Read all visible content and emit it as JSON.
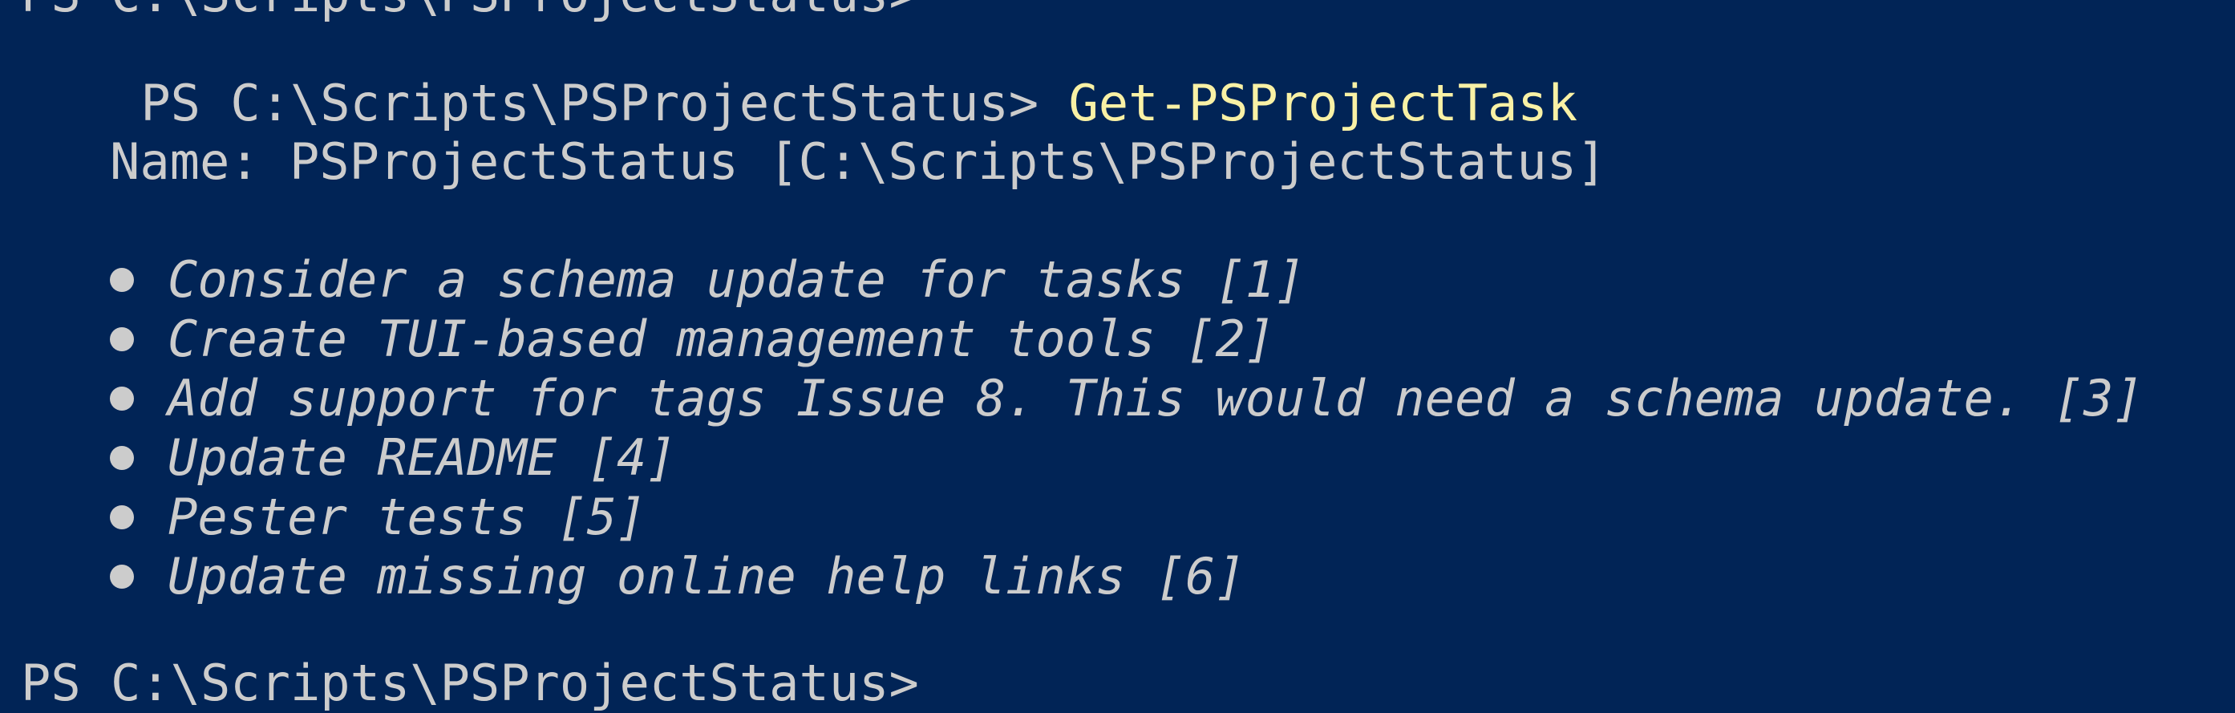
{
  "terminal": {
    "previous_prompt": "PS C:\\Scripts\\PSProjectStatus>",
    "prompt": "PS C:\\Scripts\\PSProjectStatus>",
    "command": "Get-PSProjectTask",
    "name_line": "Name: PSProjectStatus [C:\\Scripts\\PSProjectStatus]",
    "next_prompt": "PS C:\\Scripts\\PSProjectStatus>",
    "tasks": [
      {
        "icon": "bullet-icon",
        "text": "Consider a schema update for tasks [1]"
      },
      {
        "icon": "bullet-icon",
        "text": "Create TUI-based management tools [2]"
      },
      {
        "icon": "bullet-icon",
        "text": "Add support for tags Issue 8. This would need a schema update. [3]"
      },
      {
        "icon": "bullet-icon",
        "text": "Update README [4]"
      },
      {
        "icon": "bullet-icon",
        "text": "Pester tests [5]"
      },
      {
        "icon": "bullet-icon",
        "text": "Update missing online help links [6]"
      }
    ],
    "colors": {
      "background": "#012456",
      "text": "#cccccc",
      "command": "#f9f1a5"
    }
  }
}
